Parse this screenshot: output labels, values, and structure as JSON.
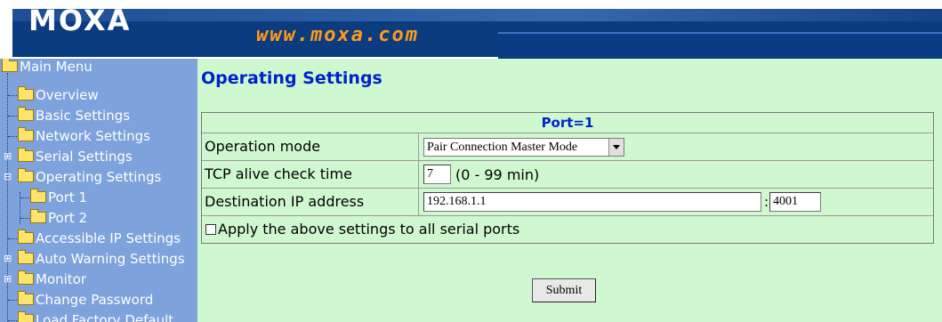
{
  "header": {
    "logo": "MOXA",
    "url": "www.moxa.com"
  },
  "menu": {
    "root": "Main Menu",
    "items": [
      "Overview",
      "Basic Settings",
      "Network Settings",
      "Serial Settings",
      "Operating Settings",
      "Port 1",
      "Port 2",
      "Accessible IP Settings",
      "Auto Warning Settings",
      "Monitor",
      "Change Password",
      "Load Factory Default"
    ]
  },
  "main": {
    "title": "Operating Settings",
    "port_header": "Port=1",
    "operation_mode_label": "Operation mode",
    "operation_mode_value": "Pair Connection Master Mode",
    "tcp_alive_label": "TCP alive check time",
    "tcp_alive_value": "7",
    "tcp_alive_hint": "(0 - 99 min)",
    "dest_ip_label": "Destination IP address",
    "dest_ip_value": "192.168.1.1",
    "dest_port_separator": ":",
    "dest_port_value": "4001",
    "apply_all_label": "Apply the above settings to all serial ports",
    "submit_label": "Submit"
  },
  "colors": {
    "menu_bg": "#7ea2dc",
    "content_bg": "#d0f8d0",
    "title_blue": "#0022cc",
    "banner_blue": "#0c3c80",
    "url_orange": "#ff9a1c"
  }
}
